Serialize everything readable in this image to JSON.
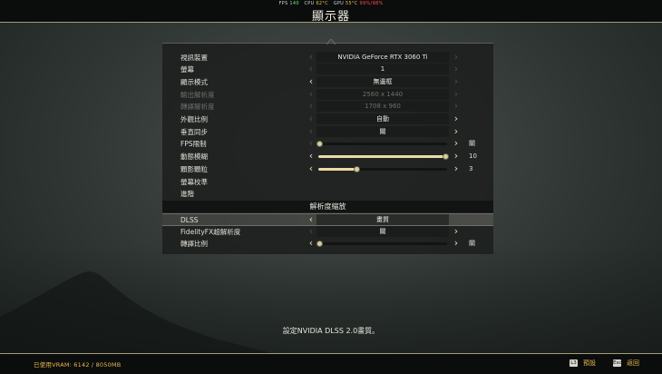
{
  "perf_overlay": {
    "fps_label": "FPS",
    "fps_value": "140",
    "cpu_label": "CPU",
    "cpu_temp": "62°C",
    "gpu_label": "GPU",
    "gpu_temp": "55°C",
    "gpu_extra": "99%/98%"
  },
  "page_title": "顯示器",
  "settings": [
    {
      "label": "視訊裝置",
      "value": "NVIDIA GeForce RTX 3060 Ti"
    },
    {
      "label": "螢幕",
      "value": "1"
    },
    {
      "label": "顯示模式",
      "value": "無邊框"
    },
    {
      "label": "輸出解析度",
      "value": "2560 x 1440"
    },
    {
      "label": "轉譯解析度",
      "value": "1708 x 960"
    },
    {
      "label": "外觀比例",
      "value": "自動"
    },
    {
      "label": "垂直同步",
      "value": "關"
    },
    {
      "label": "FPS限制",
      "side_value": "關",
      "level": 0
    },
    {
      "label": "動態模糊",
      "side_value": "10",
      "level": 1.0
    },
    {
      "label": "顆影顆粒",
      "side_value": "3",
      "level": 0.3
    },
    {
      "label": "螢幕校準"
    },
    {
      "label": "進階"
    }
  ],
  "section_header": "解析度縮放",
  "scaling": [
    {
      "label": "DLSS",
      "value": "畫質"
    },
    {
      "label": "FidelityFX超解析度",
      "value": "關"
    },
    {
      "label": "轉譯比例",
      "side_value": "關",
      "level": 0
    }
  ],
  "description": "設定NVIDIA DLSS 2.0畫質。",
  "footer": {
    "vram_text": "已使用VRAM: 6142 / 8050MB",
    "default_key": "L3",
    "default_label": "預設",
    "back_key": "Esc",
    "back_label": "返回"
  },
  "colors": {
    "accent": "#e8b84c",
    "slider_fill": "#e9dca8"
  }
}
